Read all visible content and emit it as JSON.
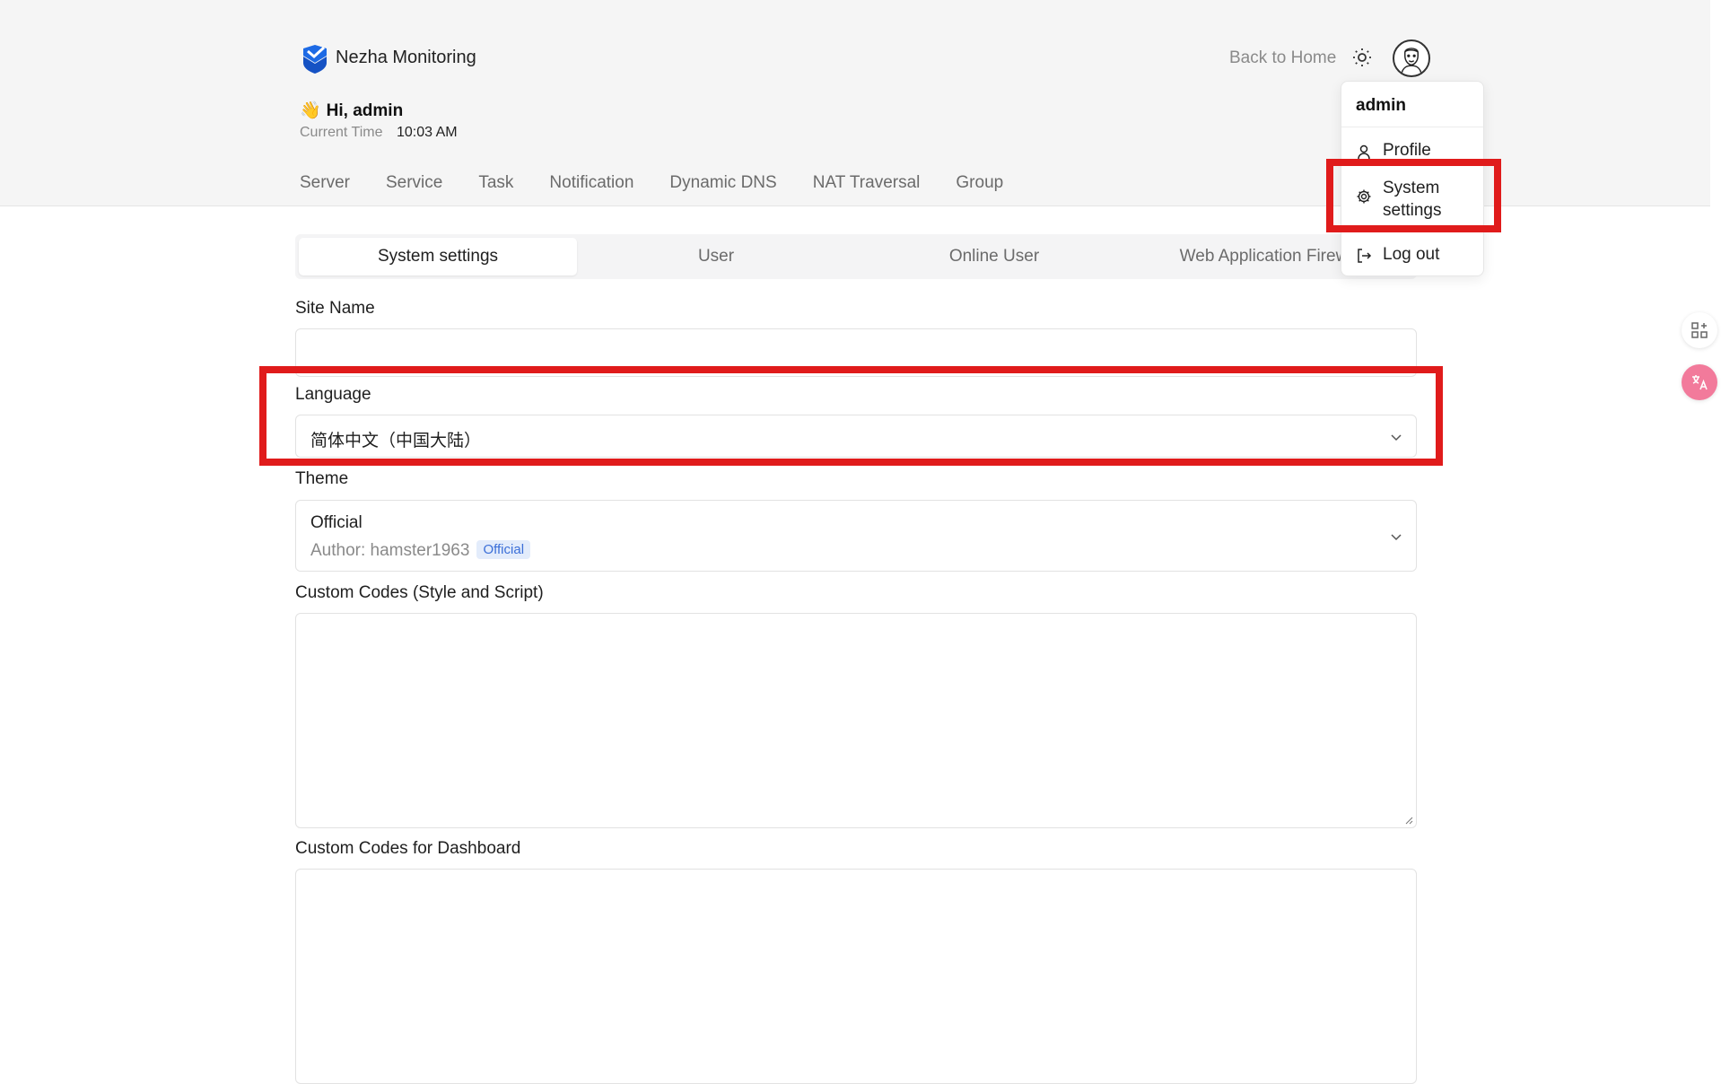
{
  "app": {
    "brand": "Nezha Monitoring",
    "back_home": "Back to Home",
    "greeting_emoji": "👋",
    "greeting": "Hi, admin",
    "time_label": "Current Time",
    "time_value": "10:03 AM"
  },
  "nav": {
    "items": [
      "Server",
      "Service",
      "Task",
      "Notification",
      "Dynamic DNS",
      "NAT Traversal",
      "Group"
    ]
  },
  "tabs": {
    "items": [
      "System settings",
      "User",
      "Online User",
      "Web Application Firewall"
    ],
    "active": "System settings"
  },
  "form": {
    "site_name_label": "Site Name",
    "site_name_value": "",
    "language_label": "Language",
    "language_value": "简体中文（中国大陆）",
    "theme_label": "Theme",
    "theme_name": "Official",
    "theme_author": "Author: hamster1963",
    "theme_badge": "Official",
    "custom_codes_label": "Custom Codes (Style and Script)",
    "custom_codes_value": "",
    "dashboard_codes_label": "Custom Codes for Dashboard",
    "dashboard_codes_value": ""
  },
  "user_menu": {
    "username": "admin",
    "profile": "Profile",
    "system_settings_line1": "System",
    "system_settings_line2": "settings",
    "logout": "Log out"
  },
  "icons": {
    "logo": "nezha-shield-logo",
    "theme_toggle": "sun-icon",
    "avatar": "avatar",
    "profile": "user-icon",
    "settings": "gear-icon",
    "logout": "logout-icon",
    "chevron": "chevron-down-icon",
    "side_grid": "apps-grid-icon",
    "side_translate": "translate-icon"
  },
  "colors": {
    "highlight": "#e01b1b",
    "badge_text": "#3b6fd8",
    "badge_bg": "#e3ecfb",
    "logo_blue": "#1d6ae5"
  }
}
